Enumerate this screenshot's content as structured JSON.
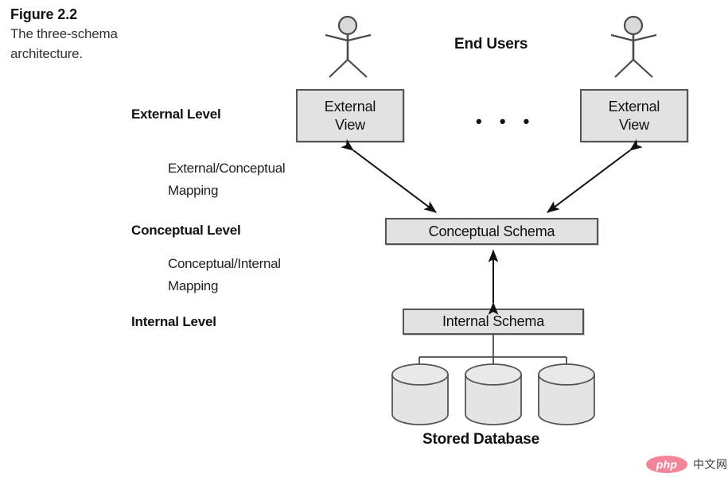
{
  "figure": {
    "title": "Figure 2.2",
    "caption_line1": "The three-schema",
    "caption_line2": "architecture."
  },
  "levels": {
    "external": "External Level",
    "conceptual": "Conceptual Level",
    "internal": "Internal Level"
  },
  "mappings": {
    "external_conceptual_line1": "External/Conceptual",
    "external_conceptual_line2": "Mapping",
    "conceptual_internal_line1": "Conceptual/Internal",
    "conceptual_internal_line2": "Mapping"
  },
  "nodes": {
    "end_users": "End Users",
    "external_view_left_line1": "External",
    "external_view_left_line2": "View",
    "external_view_right_line1": "External",
    "external_view_right_line2": "View",
    "ellipsis": "• • •",
    "conceptual_schema": "Conceptual Schema",
    "internal_schema": "Internal Schema",
    "stored_database": "Stored Database"
  },
  "colors": {
    "box_fill": "#e2e2e2",
    "box_stroke": "#555555",
    "cylinder_fill": "#e4e4e4",
    "cylinder_stroke": "#555555",
    "text": "#111111",
    "watermark_pink": "#f2859a"
  },
  "watermark": {
    "brand": "php",
    "text": "中文网"
  }
}
